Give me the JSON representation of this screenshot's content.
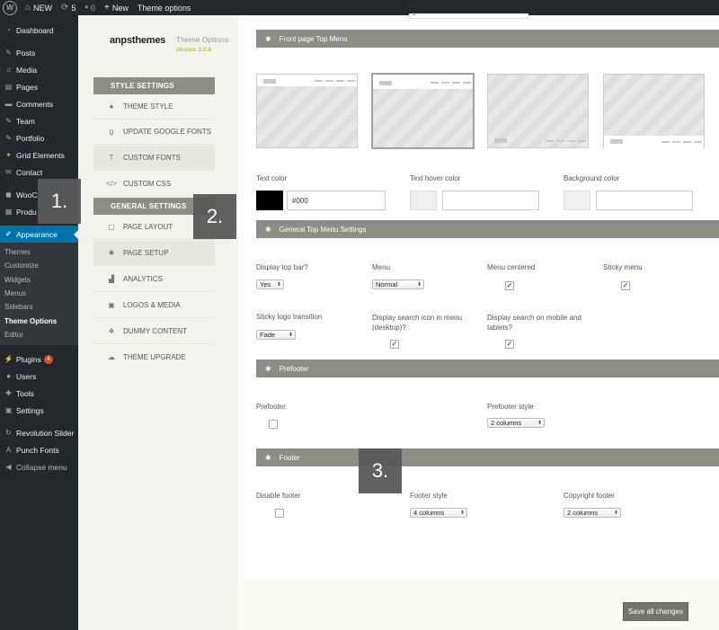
{
  "admin_bar": {
    "site_name": "NEW",
    "updates_count": "5",
    "comments_count": "0",
    "new_label": "New",
    "theme_options_label": "Theme options"
  },
  "admin_menu": {
    "items": [
      {
        "label": "Dashboard",
        "icon": "dashboard-icon"
      },
      {
        "label": "Posts",
        "icon": "pin-icon"
      },
      {
        "label": "Media",
        "icon": "media-icon"
      },
      {
        "label": "Pages",
        "icon": "pages-icon"
      },
      {
        "label": "Comments",
        "icon": "comment-icon"
      },
      {
        "label": "Team",
        "icon": "pin-icon"
      },
      {
        "label": "Portfolio",
        "icon": "pin-icon"
      },
      {
        "label": "Grid Elements",
        "icon": "grid-icon"
      },
      {
        "label": "Contact",
        "icon": "mail-icon"
      },
      {
        "label": "WooC",
        "icon": "woo-icon"
      },
      {
        "label": "Produ",
        "icon": "cart-icon"
      },
      {
        "label": "Appearance",
        "icon": "brush-icon"
      }
    ],
    "appearance_submenu": [
      "Themes",
      "Customize",
      "Widgets",
      "Menus",
      "Sidebars",
      "Theme Options",
      "Editor"
    ],
    "lower_items": [
      {
        "label": "Plugins",
        "icon": "plugin-icon",
        "badge": "4"
      },
      {
        "label": "Users",
        "icon": "user-icon"
      },
      {
        "label": "Tools",
        "icon": "wrench-icon"
      },
      {
        "label": "Settings",
        "icon": "settings-icon"
      },
      {
        "label": "Revolution Slider",
        "icon": "refresh-icon"
      },
      {
        "label": "Punch Fonts",
        "icon": "font-icon"
      },
      {
        "label": "Collapse menu",
        "icon": "collapse-icon"
      }
    ]
  },
  "options_nav": {
    "brand": "anpsthemes",
    "title": "Theme Options",
    "version": "version: 2.0.8",
    "style_section": "STYLE SETTINGS",
    "general_section": "GENERAL SETTINGS",
    "items": {
      "theme_style": "THEME STYLE",
      "google_fonts": "UPDATE GOOGLE FONTS",
      "custom_fonts": "CUSTOM FONTS",
      "custom_css": "CUSTOM CSS",
      "page_layout": "PAGE LAYOUT",
      "page_setup": "PAGE SETUP",
      "analytics": "ANALYTICS",
      "logos_media": "LOGOS & MEDIA",
      "dummy_content": "DUMMY CONTENT",
      "theme_upgrade": "THEME UPGRADE"
    }
  },
  "main": {
    "front_page_section": "Front page Top Menu",
    "text_color_label": "Text color",
    "text_color_value": "#000",
    "text_hover_label": "Text hover color",
    "bg_color_label": "Background color",
    "general_top_menu_section": "General Top Menu Settings",
    "display_top_bar_label": "Display top bar?",
    "display_top_bar_value": "Yes",
    "menu_label": "Menu",
    "menu_value": "Normal",
    "menu_centered_label": "Menu centered",
    "sticky_menu_label": "Sticky menu",
    "sticky_logo_label": "Sticky logo transition",
    "sticky_logo_value": "Fade",
    "search_icon_label": "Display search icon in menu (desktop)?",
    "search_mobile_label": "Display search on mobile and tablets?",
    "prefooter_section": "Prefooter",
    "prefooter_label": "Prefooter",
    "prefooter_style_label": "Prefooter style",
    "prefooter_style_value": "2 columns",
    "footer_section": "Footer",
    "disable_footer_label": "Disable footer",
    "footer_style_label": "Footer style",
    "footer_style_value": "4 columns",
    "copyright_footer_label": "Copyright footer",
    "copyright_footer_value": "2 columns",
    "save_button": "Save all changes",
    "checkbox_states": {
      "menu_centered": true,
      "sticky_menu": true,
      "search_icon": true,
      "search_mobile": true,
      "prefooter": false,
      "disable_footer": false
    }
  },
  "callouts": [
    "1.",
    "2.",
    "3."
  ],
  "colors": {
    "admin_bg": "#23282d",
    "active_blue": "#0073aa",
    "section_header": "#8d8d83",
    "text_color_swatch": "#000000",
    "version_green": "#8cb00f"
  }
}
